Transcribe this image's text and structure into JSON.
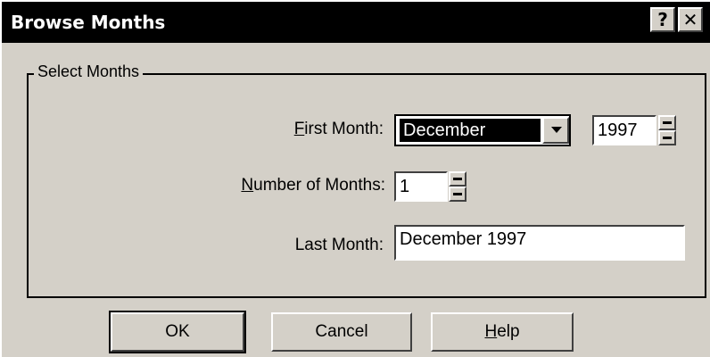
{
  "window": {
    "title": "Browse Months",
    "help_glyph": "?",
    "close_glyph": "✕"
  },
  "group": {
    "label": "Select Months"
  },
  "first_month": {
    "label_accel": "F",
    "label_rest": "irst Month:",
    "selected_month": "December",
    "year": "1997"
  },
  "number_of_months": {
    "label_accel": "N",
    "label_rest": "umber of Months:",
    "value": "1"
  },
  "last_month": {
    "label": "Last Month:",
    "value": "December 1997"
  },
  "buttons": {
    "ok": "OK",
    "cancel": "Cancel",
    "help_accel": "H",
    "help_rest": "elp"
  },
  "icons": [
    "help-icon",
    "close-icon",
    "chevron-down-icon",
    "spin-up-icon",
    "spin-down-icon"
  ]
}
